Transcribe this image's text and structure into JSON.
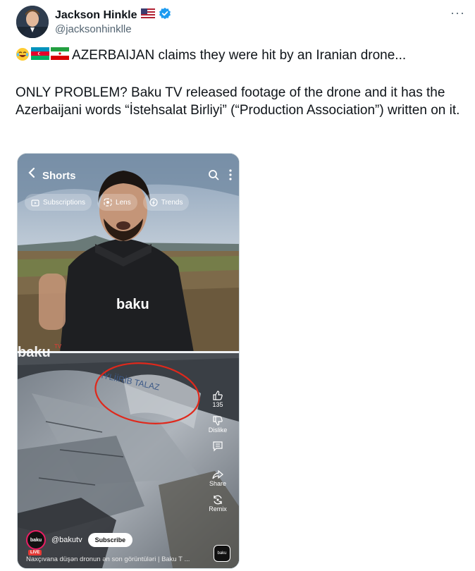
{
  "author": {
    "name": "Jackson Hinkle",
    "handle": "@jacksonhinklle",
    "flag_icon": "us-flag-icon",
    "verified_icon": "verified-badge-icon"
  },
  "more_label": "···",
  "tweet": {
    "line1": "AZERBAIJAN claims they were hit by an Iranian drone...",
    "line2": "ONLY PROBLEM? Baku TV released footage of the drone and it has the Azerbaijani words “İstehsalat Birliyi” (“Production Association”) written on it.",
    "emojis": [
      "laughing-emoji-icon",
      "azerbaijan-flag-icon",
      "iran-flag-icon"
    ]
  },
  "media": {
    "app_title": "Shorts",
    "chips": [
      "Subscriptions",
      "Lens",
      "Trends"
    ],
    "vest_text": "baku",
    "watermark": "baku",
    "watermark_tv": "TV",
    "drone_text": "İYLİİRİB TALAZ",
    "actions": {
      "like_count": "135",
      "dislike_label": "Dislike",
      "share_label": "Share",
      "remix_label": "Remix"
    },
    "channel_logo": "baku",
    "channel_live": "LIVE",
    "channel_name": "@bakutv",
    "subscribe_label": "Subscribe",
    "caption": "Naxçıvana düşən dronun ən son görüntüləri | Baku T ...",
    "corner_badge": "baku"
  },
  "colors": {
    "verified": "#1d9bf0",
    "annotation_circle": "#e0281b",
    "secondary_text": "#536471"
  }
}
